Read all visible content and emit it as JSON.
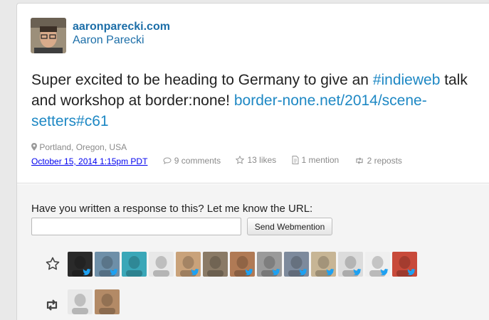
{
  "post": {
    "author_url": "aaronparecki.com",
    "author_name": "Aaron Parecki",
    "content_text": "Super excited to be heading to Germany to give an ",
    "hashtag": "#indieweb",
    "content_text2": " talk and workshop at border:none! ",
    "link": "border-none.net/2014/scene-setters#c61",
    "location": "Portland, Oregon, USA",
    "date": "October 15, 2014 1:15pm PDT",
    "comments": "9 comments",
    "likes": "13 likes",
    "mentions": "1 mention",
    "reposts": "2 reposts"
  },
  "webmention": {
    "prompt": "Have you written a response to this? Let me know the URL:",
    "input_value": "",
    "button_label": "Send Webmention"
  },
  "likes_row": {
    "icon": "star-icon",
    "faces": [
      {
        "color": "#2a2a2a",
        "twitter": true
      },
      {
        "color": "#6e8fa8",
        "twitter": true
      },
      {
        "color": "#3aa7b8",
        "twitter": false
      },
      {
        "color": "#e8e8e8",
        "twitter": false
      },
      {
        "color": "#c9a27a",
        "twitter": true
      },
      {
        "color": "#8a7a66",
        "twitter": false
      },
      {
        "color": "#b07a55",
        "twitter": true
      },
      {
        "color": "#9a9a9a",
        "twitter": true
      },
      {
        "color": "#7d8a9c",
        "twitter": true
      },
      {
        "color": "#c7b595",
        "twitter": true
      },
      {
        "color": "#dcdcdc",
        "twitter": true
      },
      {
        "color": "#efefef",
        "twitter": true
      },
      {
        "color": "#c84a3a",
        "twitter": true
      }
    ]
  },
  "reposts_row": {
    "icon": "repost-icon",
    "faces": [
      {
        "color": "#e8e8e8",
        "twitter": false
      },
      {
        "color": "#b38a66",
        "twitter": false
      }
    ]
  },
  "colors": {
    "link": "#1e88c4",
    "twitter": "#1da1f2"
  }
}
